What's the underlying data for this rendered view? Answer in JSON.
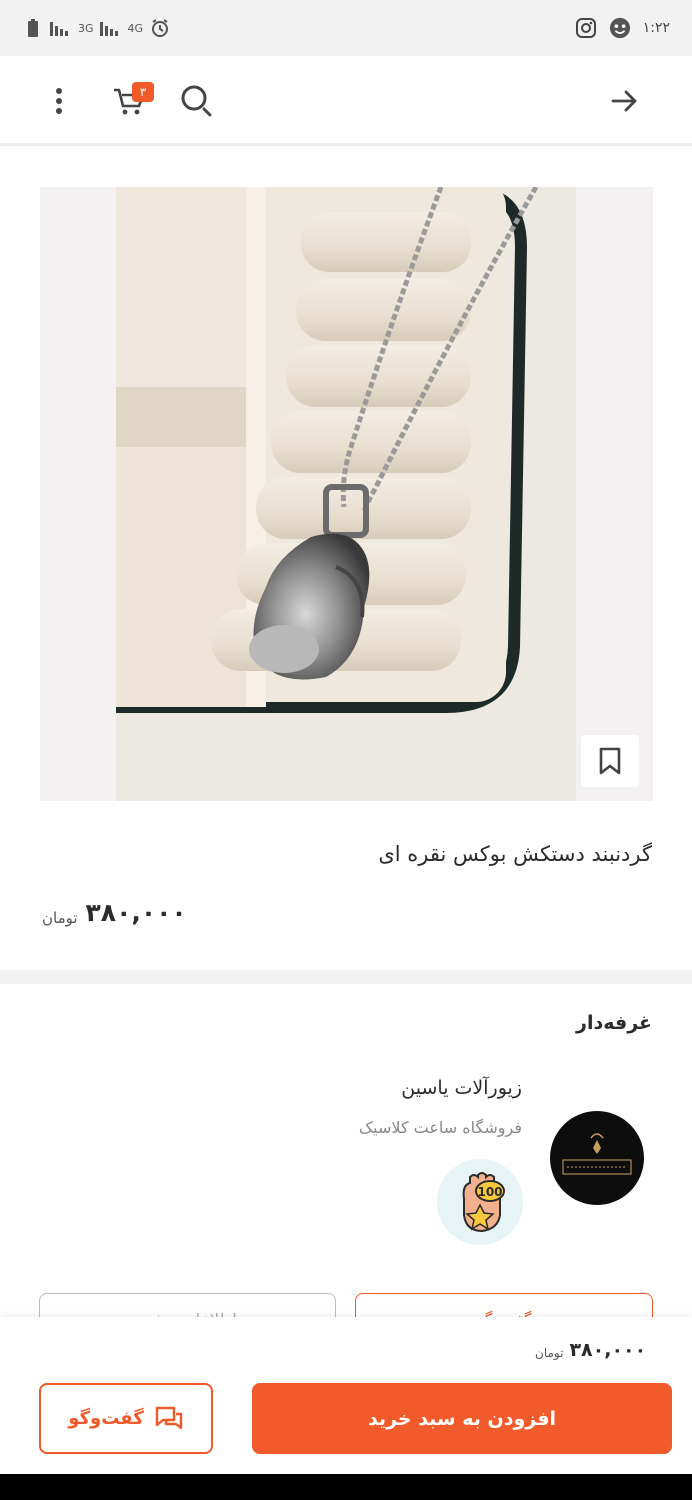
{
  "status_bar": {
    "time": "۱:۲۲",
    "network": "3G",
    "network2": "4G",
    "icons": [
      "battery-icon",
      "signal-icon",
      "alarm-icon",
      "instagram-icon",
      "emoji-icon"
    ]
  },
  "app_bar": {
    "cart_count": "۳",
    "icons": [
      "more-vert-icon",
      "cart-icon",
      "search-icon",
      "arrow-forward-icon"
    ]
  },
  "product": {
    "title": "گردنبند دستکش بوکس نقره ای",
    "price": "۳۸۰,۰۰۰",
    "currency": "تومان"
  },
  "seller": {
    "section_title": "غرفه‌دار",
    "name": "زیورآلات یاسین",
    "subtitle": "فروشگاه ساعت کلاسیک",
    "avatar_logo_text": "Crescent Collection",
    "badge_label": "100"
  },
  "ghost_buttons": {
    "left_label": "اطلاعات بیشتر",
    "right_label": "گفت‌وگو"
  },
  "bottom_bar": {
    "price": "۳۸۰,۰۰۰",
    "currency": "تومان",
    "add_to_cart": "افزودن به سبد خرید",
    "chat": "گفت‌وگو"
  },
  "colors": {
    "accent": "#f05a28",
    "badge_bg": "#e6f4f6",
    "divider": "#f1f1f1"
  }
}
